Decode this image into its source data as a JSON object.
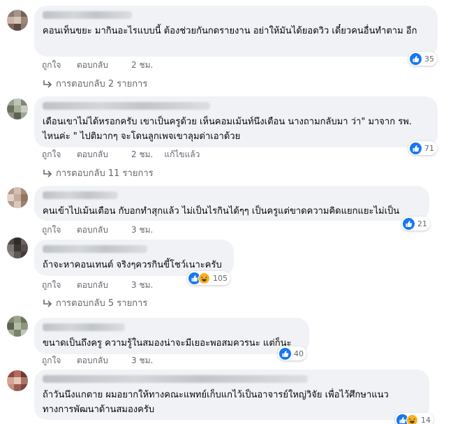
{
  "comments": [
    {
      "text": "คอนเท็นขยะ มากินอะไรแบบนี้ ต้องช่วยกันกดรายงาน อย่าให้มันได้ยอดวิว เดี๋ยวคนอื่นทำตาม อีก",
      "like": "ถูกใจ",
      "reply": "ตอบกลับ",
      "time": "2 ชม.",
      "replies": "การตอบกลับ 2 รายการ",
      "reaction_count": "35",
      "reactions": [
        "like-icon"
      ]
    },
    {
      "text": "เดือนเขาไม่ได้หรอกครับ เขาเป็นครูด้วย เห็นคอมเม้นท์นึงเตือน นางถามกลับมา ว่า\" มาจาก รพ. ไหนค่ะ \" ไปติมากๆ จะโดนลูกเพจเขาลุมด่าเอาด้วย",
      "like": "ถูกใจ",
      "reply": "ตอบกลับ",
      "time": "2 ชม.",
      "edited": "แก้ไขแล้ว",
      "replies": "การตอบกลับ 11 รายการ",
      "reaction_count": "71",
      "reactions": [
        "like-icon"
      ]
    },
    {
      "text": "คนเข้าไปเม้นเตือน กับอกทำสุกแล้ว ไม่เป็นไรกินได้ๆๆ เป็นครูแต่ขาดความคิดแยกแยะไม่เป็น",
      "like": "ถูกใจ",
      "reply": "ตอบกลับ",
      "time": "3 ชม.",
      "reaction_count": "21",
      "reactions": [
        "like-icon"
      ]
    },
    {
      "text": "ถ้าจะหาคอนเทนต์ จริงๆควรกินขี้โชว์เนาะครับ",
      "like": "ถูกใจ",
      "reply": "ตอบกลับ",
      "time": "3 ชม.",
      "replies": "การตอบกลับ 5 รายการ",
      "reaction_count": "105",
      "reactions": [
        "like-icon",
        "haha-icon"
      ]
    },
    {
      "text": "ขนาดเป็นถึงครู ความรู้ในสมองน่าจะมีเยอะพอสมควรนะ แต่ก็นะ",
      "like": "ถูกใจ",
      "reply": "ตอบกลับ",
      "time": "3 ชม.",
      "reaction_count": "40",
      "reactions": [
        "like-icon"
      ]
    },
    {
      "text": "ถ้าวันนึงแกตาย ผมอยากให้ทางคณะแพทย์เก็บแกไว้เป็นอาจารย์ใหญ่วิจัย เพื่อไว้ศึกษาแนว ทางการพัฒนาด้านสมองครับ",
      "reaction_count": "14",
      "reactions": [
        "like-icon",
        "haha-icon"
      ]
    }
  ],
  "colors": {
    "bubble": "#f0f2f5",
    "meta": "#65676b",
    "like_blue": "#1877f2",
    "haha_yellow": "#f7b125"
  }
}
